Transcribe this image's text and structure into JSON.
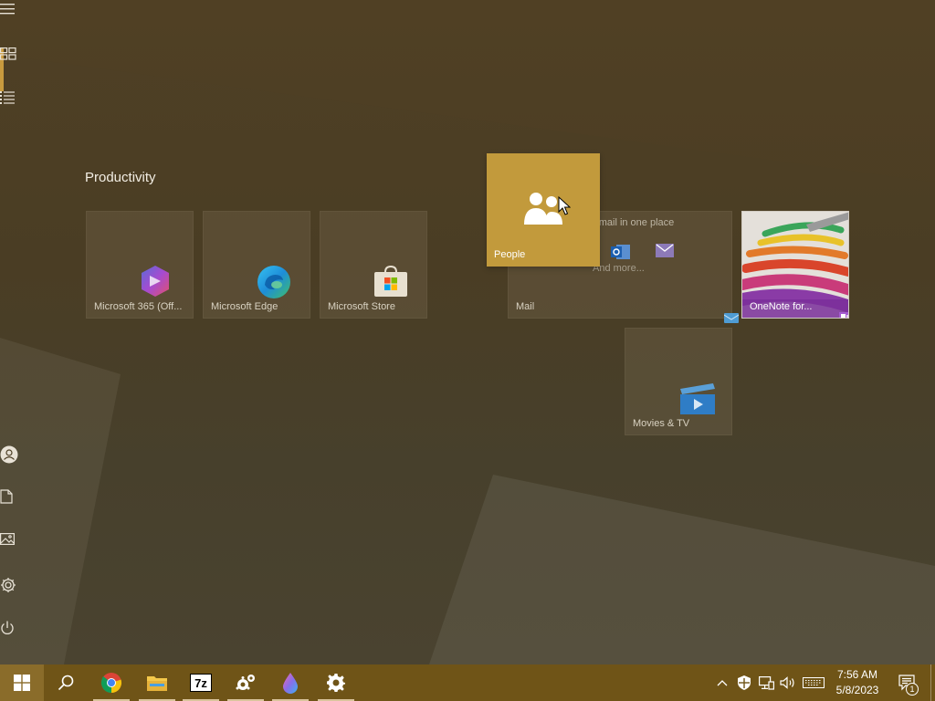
{
  "start_menu": {
    "rail": {
      "top_icons": [
        {
          "name": "expand-menu-icon"
        },
        {
          "name": "pinned-tiles-icon",
          "active": true
        },
        {
          "name": "all-apps-list-icon"
        }
      ],
      "bottom_icons": [
        {
          "name": "user-account-icon"
        },
        {
          "name": "documents-icon"
        },
        {
          "name": "pictures-icon"
        },
        {
          "name": "settings-icon"
        },
        {
          "name": "power-icon"
        }
      ]
    },
    "group_title": "Productivity",
    "tiles": {
      "m365": {
        "label": "Microsoft 365 (Off...",
        "icon": "microsoft-365-icon"
      },
      "edge": {
        "label": "Microsoft Edge",
        "icon": "edge-icon"
      },
      "store": {
        "label": "Microsoft Store",
        "icon": "store-icon"
      },
      "mail": {
        "label": "Mail",
        "tagline": "r mail in one place",
        "more": "And more...",
        "icon": "mail-icon"
      },
      "onenote": {
        "label": "OneNote for...",
        "icon": "onenote-icon"
      },
      "movies": {
        "label": "Movies & TV",
        "icon": "movies-tv-icon"
      },
      "people": {
        "label": "People",
        "icon": "people-icon",
        "state": "dragging"
      }
    }
  },
  "taskbar": {
    "apps": [
      {
        "name": "start-button"
      },
      {
        "name": "search-button"
      },
      {
        "name": "chrome-icon",
        "running": true
      },
      {
        "name": "file-explorer-icon",
        "running": true
      },
      {
        "name": "7zip-icon",
        "running": true
      },
      {
        "name": "settings-gears-icon",
        "running": true
      },
      {
        "name": "paint-drop-icon",
        "running": true
      },
      {
        "name": "settings-icon",
        "running": true
      }
    ],
    "tray": {
      "time": "7:56 AM",
      "date": "5/8/2023",
      "notification_count": "1"
    }
  },
  "colors": {
    "accent": "#c29a3c",
    "taskbar": "#6f5417",
    "background": "#4a3c22"
  }
}
